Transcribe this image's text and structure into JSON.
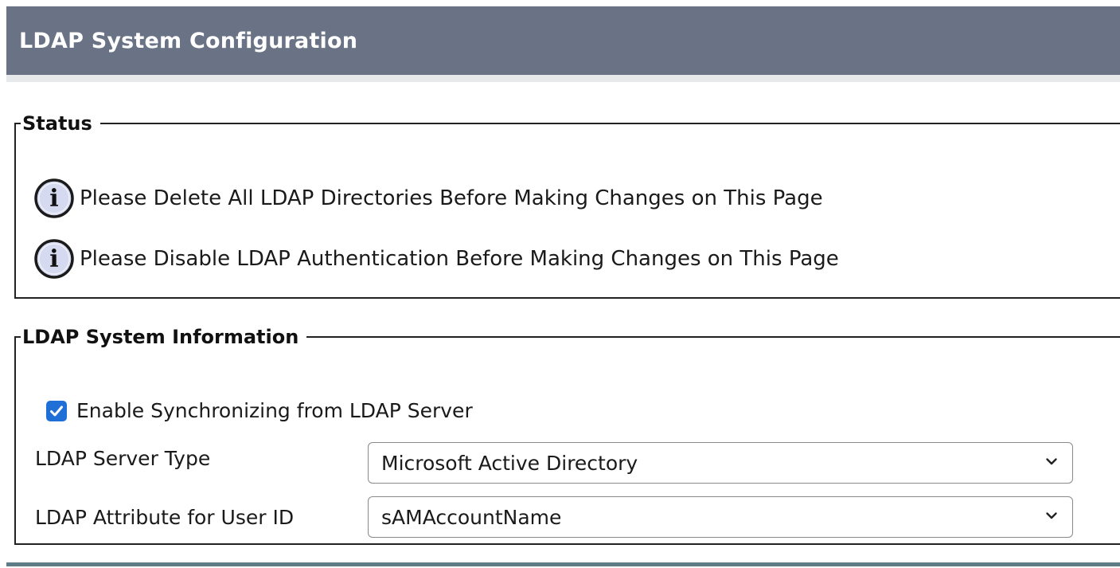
{
  "header": {
    "title": "LDAP System Configuration"
  },
  "status": {
    "legend": "Status",
    "messages": [
      {
        "icon": "info-icon",
        "text": "Please Delete All LDAP Directories Before Making Changes on This Page"
      },
      {
        "icon": "info-icon",
        "text": "Please Disable LDAP Authentication Before Making Changes on This Page"
      }
    ]
  },
  "ldap_info": {
    "legend": "LDAP System Information",
    "sync_checkbox": {
      "label": "Enable Synchronizing from LDAP Server",
      "checked": true
    },
    "server_type": {
      "label": "LDAP Server Type",
      "value": "Microsoft Active Directory"
    },
    "user_id_attribute": {
      "label": "LDAP Attribute for User ID",
      "value": "sAMAccountName"
    }
  },
  "colors": {
    "header_bg": "#697385",
    "checkbox_accent": "#1f6fd6",
    "icon_fill": "#d6daf0"
  }
}
